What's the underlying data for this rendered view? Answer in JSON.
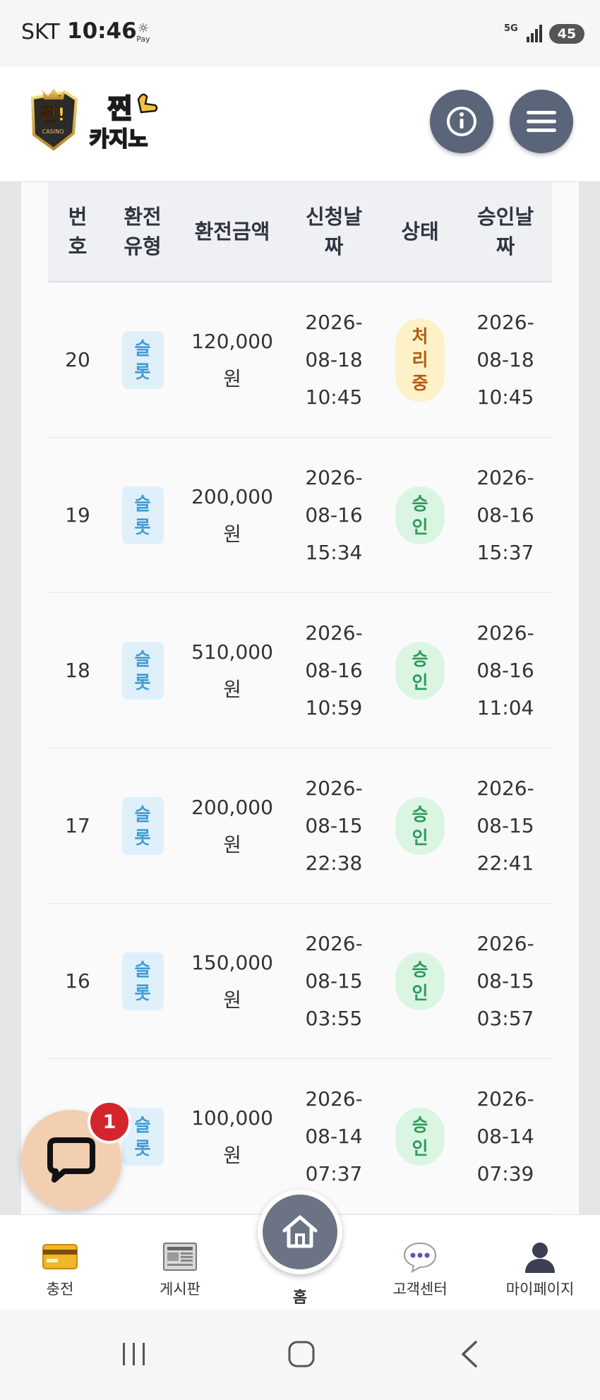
{
  "status_bar": {
    "carrier": "SKT",
    "time": "10:46",
    "pay_label": "Pay",
    "network": "5G",
    "battery": "45"
  },
  "header": {
    "logo_text_top": "찐",
    "logo_text_bottom": "카지노",
    "logo_subtext": "CASINO",
    "info_icon": "info-icon",
    "menu_icon": "hamburger-menu-icon"
  },
  "table": {
    "headers": [
      "번\n호",
      "환전\n유형",
      "환전금액",
      "신청날\n짜",
      "상태",
      "승인날\n짜"
    ],
    "rows": [
      {
        "no": "20",
        "type": "슬\n롯",
        "amount": "120,000\n원",
        "requested": "2026-\n08-18\n10:45",
        "status": "처\n리\n중",
        "status_kind": "processing",
        "approved": "2026-\n08-18\n10:45"
      },
      {
        "no": "19",
        "type": "슬\n롯",
        "amount": "200,000\n원",
        "requested": "2026-\n08-16\n15:34",
        "status": "승\n인",
        "status_kind": "approved",
        "approved": "2026-\n08-16\n15:37"
      },
      {
        "no": "18",
        "type": "슬\n롯",
        "amount": "510,000\n원",
        "requested": "2026-\n08-16\n10:59",
        "status": "승\n인",
        "status_kind": "approved",
        "approved": "2026-\n08-16\n11:04"
      },
      {
        "no": "17",
        "type": "슬\n롯",
        "amount": "200,000\n원",
        "requested": "2026-\n08-15\n22:38",
        "status": "승\n인",
        "status_kind": "approved",
        "approved": "2026-\n08-15\n22:41"
      },
      {
        "no": "16",
        "type": "슬\n롯",
        "amount": "150,000\n원",
        "requested": "2026-\n08-15\n03:55",
        "status": "승\n인",
        "status_kind": "approved",
        "approved": "2026-\n08-15\n03:57"
      },
      {
        "no": "",
        "type": "슬\n롯",
        "amount": "100,000\n원",
        "requested": "2026-\n08-14\n07:37",
        "status": "승\n인",
        "status_kind": "approved",
        "approved": "2026-\n08-14\n07:39"
      }
    ]
  },
  "chat": {
    "badge_count": "1",
    "icon": "chat-bubble-icon"
  },
  "bottom_nav": {
    "items": [
      {
        "label": "충전",
        "icon": "credit-card-icon"
      },
      {
        "label": "게시판",
        "icon": "newspaper-icon"
      },
      {
        "label": "홈",
        "icon": "home-icon"
      },
      {
        "label": "고객센터",
        "icon": "speech-bubble-icon"
      },
      {
        "label": "마이페이지",
        "icon": "user-icon"
      }
    ]
  },
  "colors": {
    "header_button": "#5b6579",
    "type_badge_bg": "#dff0fb",
    "type_badge_text": "#3f9bd3",
    "processing_bg": "#fdf1c8",
    "processing_text": "#b35a16",
    "approved_bg": "#dbf5e3",
    "approved_text": "#2e9b5a",
    "chat_bg": "#f2cfb0",
    "badge_red": "#d3262c"
  }
}
